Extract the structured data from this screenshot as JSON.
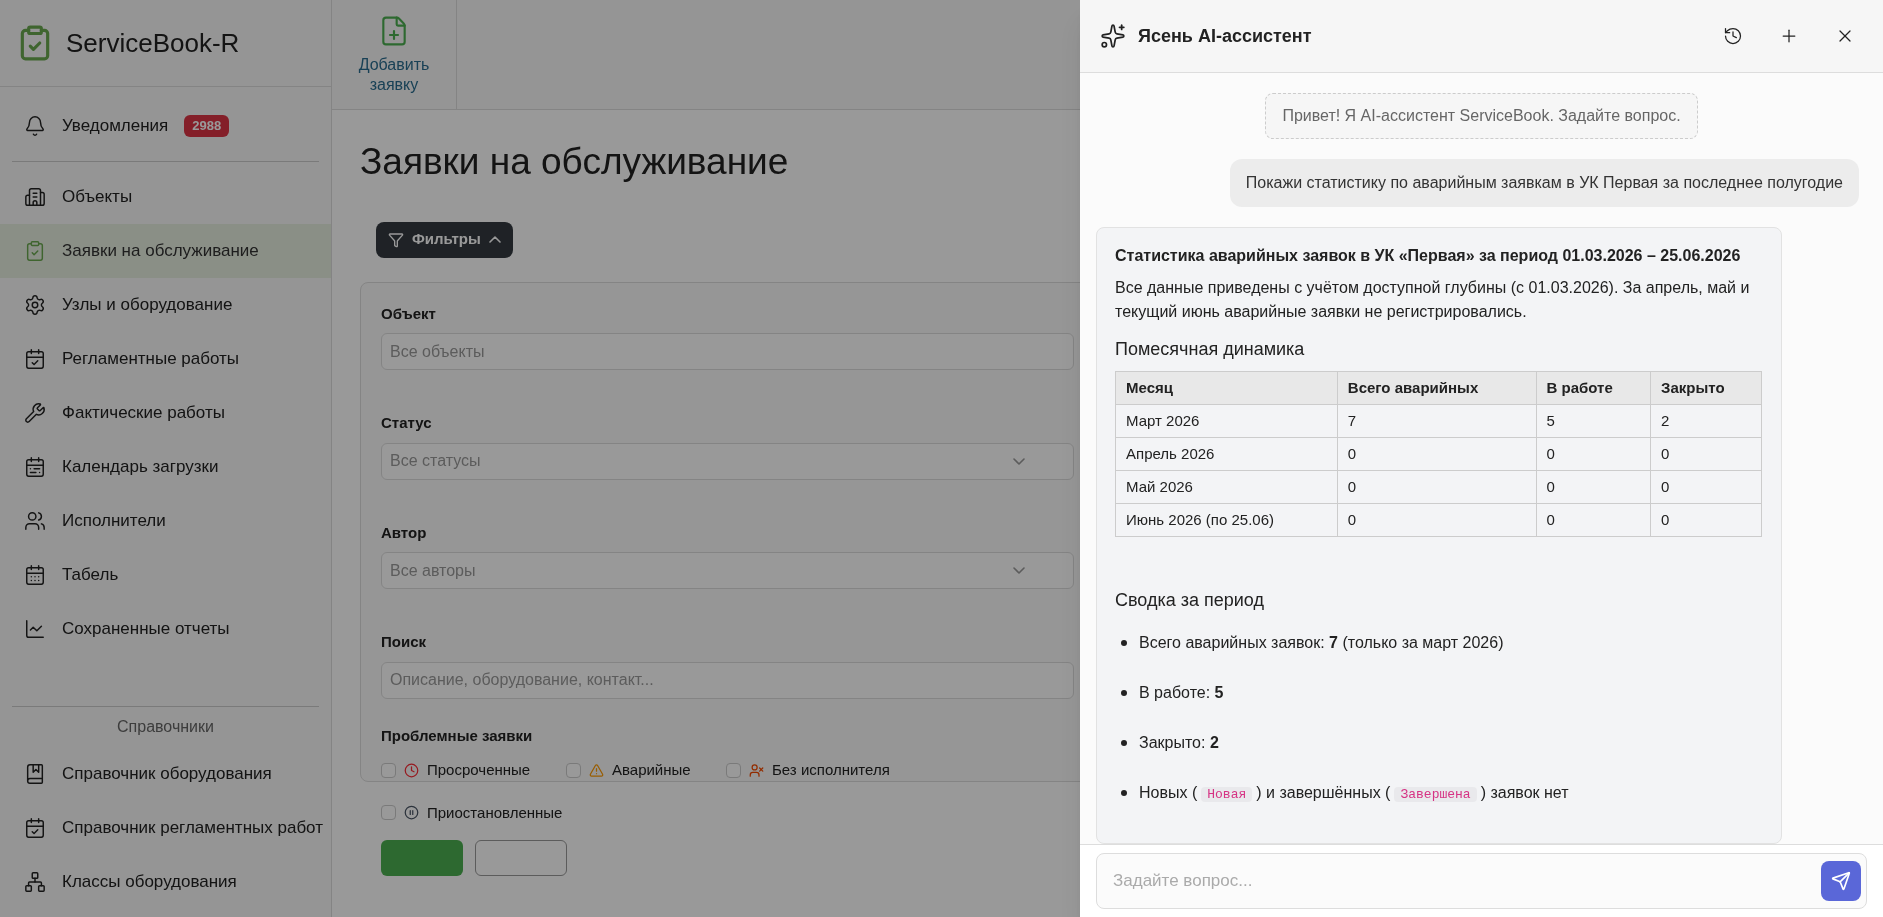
{
  "app": {
    "logo_text": "ServiceBook-R",
    "notifications": {
      "label": "Уведомления",
      "count": "2988"
    },
    "nav": [
      {
        "label": "Объекты",
        "selected": false
      },
      {
        "label": "Заявки на обслуживание",
        "selected": true
      },
      {
        "label": "Узлы и оборудование",
        "selected": false
      },
      {
        "label": "Регламентные работы",
        "selected": false
      },
      {
        "label": "Фактические работы",
        "selected": false
      },
      {
        "label": "Календарь загрузки",
        "selected": false
      },
      {
        "label": "Исполнители",
        "selected": false
      },
      {
        "label": "Табель",
        "selected": false
      },
      {
        "label": "Сохраненные отчеты",
        "selected": false
      }
    ],
    "reference": {
      "title": "Справочники",
      "items": [
        {
          "label": "Справочник оборудования",
          "selected": false
        },
        {
          "label": "Справочник регламентных работ",
          "selected": false
        },
        {
          "label": "Классы оборудования",
          "selected": false
        }
      ]
    }
  },
  "toolbar": {
    "add_button": "Добавить заявку"
  },
  "page": {
    "title": "Заявки на обслуживание",
    "filters_button": "Фильтры",
    "filters_expanded": true,
    "fields": [
      {
        "label": "Объект",
        "placeholder": "Все объекты",
        "kind": "text"
      },
      {
        "label": "Статус",
        "placeholder": "Все статусы",
        "kind": "select"
      },
      {
        "label": "Автор",
        "placeholder": "Все авторы",
        "kind": "select"
      },
      {
        "label": "Поиск",
        "placeholder": "Описание, оборудование, контакт...",
        "kind": "text"
      }
    ],
    "problems": {
      "title": "Проблемные заявки",
      "options": [
        {
          "label": "Просроченные",
          "checked": false
        },
        {
          "label": "Аварийные",
          "checked": false
        },
        {
          "label": "Без исполнителя",
          "checked": false
        },
        {
          "label": "Приостановленные",
          "checked": false
        }
      ]
    }
  },
  "assistant": {
    "title": "Ясень AI-ассистент",
    "greeting": "Привет! Я AI-ассистент ServiceBook. Задайте вопрос.",
    "user_message": "Покажи статистику по аварийным заявкам в УК Первая за последнее полугодие",
    "answer": {
      "title": "Статистика аварийных заявок в УК «Первая» за период 01.03.2026 – 25.06.2026",
      "intro": "Все данные приведены с учётом доступной глубины (с 01.03.2026). За апрель, май и текущий июнь аварийные заявки не регистрировались.",
      "table_title": "Помесячная динамика",
      "table": {
        "columns": [
          "Месяц",
          "Всего аварийных",
          "В работе",
          "Закрыто"
        ],
        "rows": [
          [
            "Март 2026",
            "7",
            "5",
            "2"
          ],
          [
            "Апрель 2026",
            "0",
            "0",
            "0"
          ],
          [
            "Май 2026",
            "0",
            "0",
            "0"
          ],
          [
            "Июнь 2026 (по 25.06)",
            "0",
            "0",
            "0"
          ]
        ]
      },
      "summary_title": "Сводка за период",
      "summary": [
        [
          {
            "kind": "text",
            "text": "Всего аварийных заявок: **7** (только за март 2026)"
          }
        ],
        [
          {
            "kind": "text",
            "text": "В работе: **5**"
          }
        ],
        [
          {
            "kind": "text",
            "text": "Закрыто: **2**"
          }
        ],
        [
          {
            "kind": "text",
            "text": "Новых ("
          },
          {
            "kind": "code",
            "text": "Новая"
          },
          {
            "kind": "text",
            "text": ") и завершённых ("
          },
          {
            "kind": "code",
            "text": "Завершена"
          },
          {
            "kind": "text",
            "text": ") заявок нет"
          }
        ]
      ]
    },
    "input_placeholder": "Задайте вопрос..."
  }
}
